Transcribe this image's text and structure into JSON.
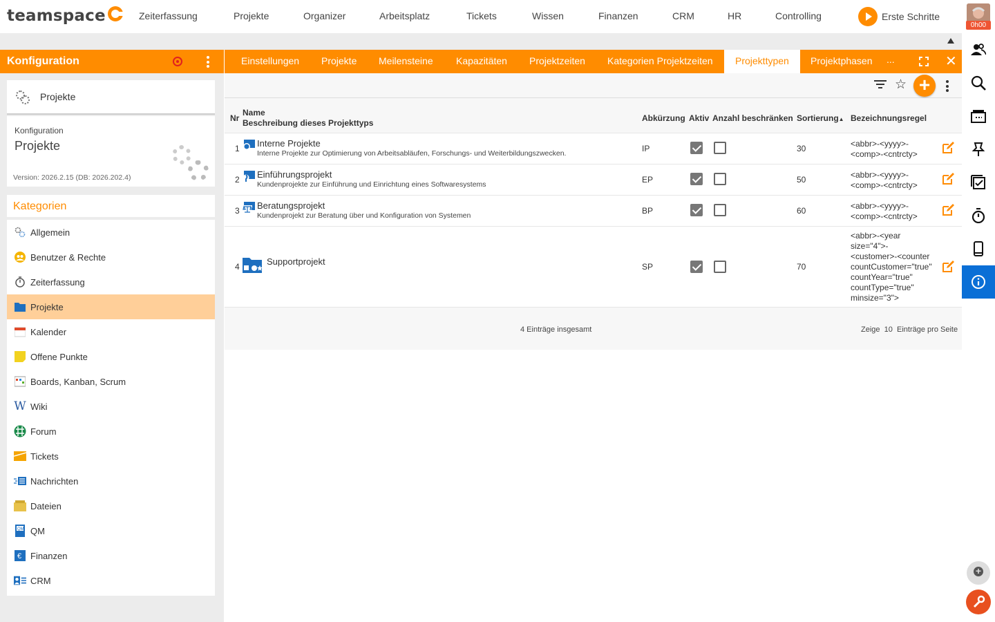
{
  "app": {
    "logo": "teamspace",
    "nav": [
      "Zeiterfassung",
      "Projekte",
      "Organizer",
      "Arbeitsplatz",
      "Tickets",
      "Wissen",
      "Finanzen",
      "CRM",
      "HR",
      "Controlling"
    ],
    "start_label": "Erste Schritte",
    "timer_badge": "0h00"
  },
  "config_panel": {
    "title": "Konfiguration",
    "selected": "Projekte",
    "info_small": "Konfiguration",
    "info_big": "Projekte",
    "version": "Version: 2026.2.15 (DB: 2026.202.4)",
    "categories_title": "Kategorien",
    "categories": [
      {
        "label": "Allgemein",
        "icon": "gears-icon"
      },
      {
        "label": "Benutzer & Rechte",
        "icon": "users-icon"
      },
      {
        "label": "Zeiterfassung",
        "icon": "stopwatch-icon"
      },
      {
        "label": "Projekte",
        "icon": "folder-icon"
      },
      {
        "label": "Kalender",
        "icon": "calendar-icon"
      },
      {
        "label": "Offene Punkte",
        "icon": "sticky-note-icon"
      },
      {
        "label": "Boards, Kanban, Scrum",
        "icon": "board-icon"
      },
      {
        "label": "Wiki",
        "icon": "wiki-icon"
      },
      {
        "label": "Forum",
        "icon": "forum-icon"
      },
      {
        "label": "Tickets",
        "icon": "ticket-icon"
      },
      {
        "label": "Nachrichten",
        "icon": "message-icon"
      },
      {
        "label": "Dateien",
        "icon": "files-icon"
      },
      {
        "label": "QM",
        "icon": "qm-icon"
      },
      {
        "label": "Finanzen",
        "icon": "euro-icon"
      },
      {
        "label": "CRM",
        "icon": "crm-icon"
      }
    ],
    "active_category": "Projekte"
  },
  "tabs": [
    "Einstellungen",
    "Projekte",
    "Meilensteine",
    "Kapazitäten",
    "Projektzeiten",
    "Kategorien Projektzeiten",
    "Projekttypen",
    "Projektphasen"
  ],
  "active_tab": "Projekttypen",
  "tab_more": "...",
  "table": {
    "headers": {
      "nr": "Nr",
      "name": "Name",
      "desc": "Beschreibung dieses Projekttyps",
      "abbr": "Abkürzung",
      "active": "Aktiv",
      "limit": "Anzahl beschränken",
      "sort": "Sortierung",
      "sort_arrow": "▲",
      "rule": "Bezeichnungsregel"
    },
    "rows": [
      {
        "nr": "1",
        "name": "Interne Projekte",
        "desc": "Interne Projekte zur Optimierung von Arbeitsabläufen, Forschungs- und Weiterbildungszwecken.",
        "abbr": "IP",
        "active": true,
        "limit": false,
        "sort": "30",
        "rule": [
          "<abbr>-<yyyy>-",
          "<comp>-<cntrcty>"
        ]
      },
      {
        "nr": "2",
        "name": "Einführungsprojekt",
        "desc": "Kundenprojekte zur Einführung und Einrichtung eines Softwaresystems",
        "abbr": "EP",
        "active": true,
        "limit": false,
        "sort": "50",
        "rule": [
          "<abbr>-<yyyy>-",
          "<comp>-<cntrcty>"
        ]
      },
      {
        "nr": "3",
        "name": "Beratungsprojekt",
        "desc": "Kundenprojekt zur Beratung über und Konfiguration von Systemen",
        "abbr": "BP",
        "active": true,
        "limit": false,
        "sort": "60",
        "rule": [
          "<abbr>-<yyyy>-",
          "<comp>-<cntrcty>"
        ]
      },
      {
        "nr": "4",
        "name": "Supportprojekt",
        "desc": "",
        "abbr": "SP",
        "active": true,
        "limit": false,
        "sort": "70",
        "rule": [
          "<abbr>-<year",
          "size=\"4\">-",
          "<customer>-<counter",
          "countCustomer=\"true\"",
          "countYear=\"true\"",
          "countType=\"true\"",
          "minsize=\"3\">"
        ]
      }
    ],
    "total": "4 Einträge insgesamt",
    "per_page_prefix": "Zeige",
    "per_page": "10",
    "per_page_suffix": "Einträge pro Seite"
  },
  "colors": {
    "accent": "#ff8c00",
    "active_sidebar": "#ffcf99",
    "info_blue": "#0a6fd6",
    "tool_red": "#e8501f"
  },
  "right_sidebar": [
    "contacts-icon",
    "search-icon",
    "inbox-icon",
    "pin-icon",
    "tasks-icon",
    "stopwatch-icon",
    "mobile-icon",
    "info-icon"
  ]
}
